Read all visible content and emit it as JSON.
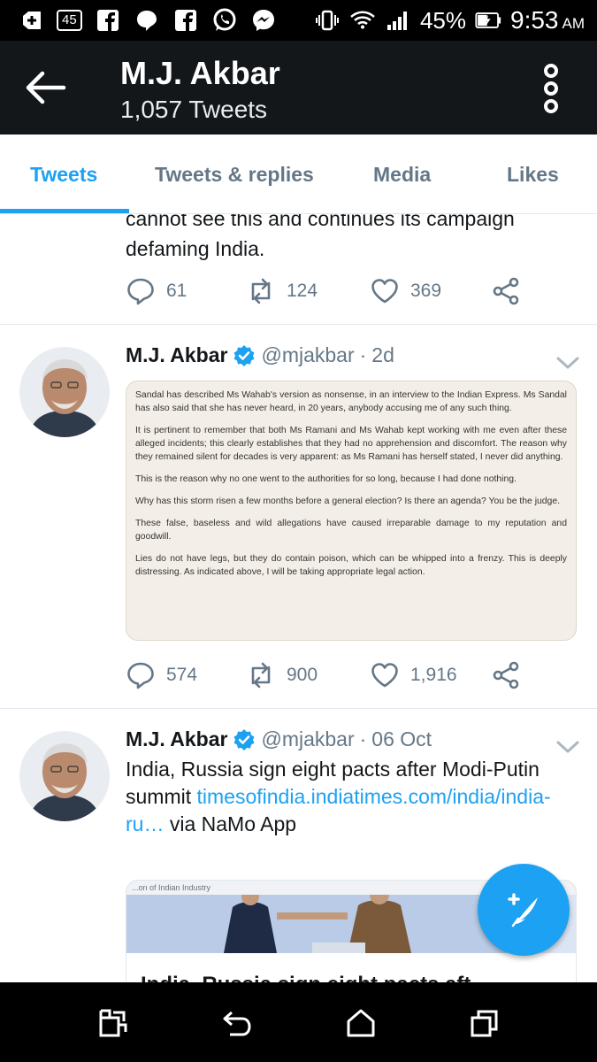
{
  "status_bar": {
    "notification_count": "45",
    "battery_percent": "45%",
    "time": "9:53",
    "ampm": "AM"
  },
  "header": {
    "title": "M.J. Akbar",
    "subtitle": "1,057 Tweets"
  },
  "tabs": [
    {
      "label": "Tweets",
      "active": true
    },
    {
      "label": "Tweets & replies",
      "active": false
    },
    {
      "label": "Media",
      "active": false
    },
    {
      "label": "Likes",
      "active": false
    }
  ],
  "tweet_partial": {
    "text_line1": "cannot see this and continues its campaign",
    "text_line2": "defaming India.",
    "replies": "61",
    "retweets": "124",
    "likes": "369"
  },
  "tweet1": {
    "name": "M.J. Akbar",
    "handle": "@mjakbar",
    "separator": "·",
    "date": "2d",
    "image_paragraphs": [
      "Sandal has described Ms Wahab's version as nonsense, in an interview to the Indian Express. Ms Sandal has also said that she has never heard, in 20 years, anybody accusing me of any such thing.",
      "It is pertinent to remember that both Ms Ramani and Ms Wahab kept working with me even after these alleged incidents; this clearly establishes that they had no apprehension and discomfort. The reason why they remained silent for decades is very apparent: as Ms Ramani has herself stated, I never did anything.",
      "This is the reason why no one went to the authorities for so long, because I had done nothing.",
      "Why has this storm risen a few months before a general election? Is there an agenda? You be the judge.",
      "These false, baseless and wild allegations have caused irreparable damage to my reputation and goodwill.",
      "Lies do not have legs, but they do contain poison, which can be whipped into a frenzy. This is deeply distressing. As indicated above, I will be taking appropriate legal action."
    ],
    "replies": "574",
    "retweets": "900",
    "likes": "1,916"
  },
  "tweet2": {
    "name": "M.J. Akbar",
    "handle": "@mjakbar",
    "separator": "·",
    "date": "06 Oct",
    "text": "India, Russia sign eight pacts after Modi-Putin summit",
    "link": "timesofindia.indiatimes.com/india/india-ru…",
    "via": "via NaMo App",
    "card_band": "...on of Indian Industry",
    "card_title": "India, Russia sign eight pacts aft..."
  },
  "colors": {
    "accent": "#1da1f2",
    "appbar": "#14171a",
    "muted": "#657786"
  }
}
